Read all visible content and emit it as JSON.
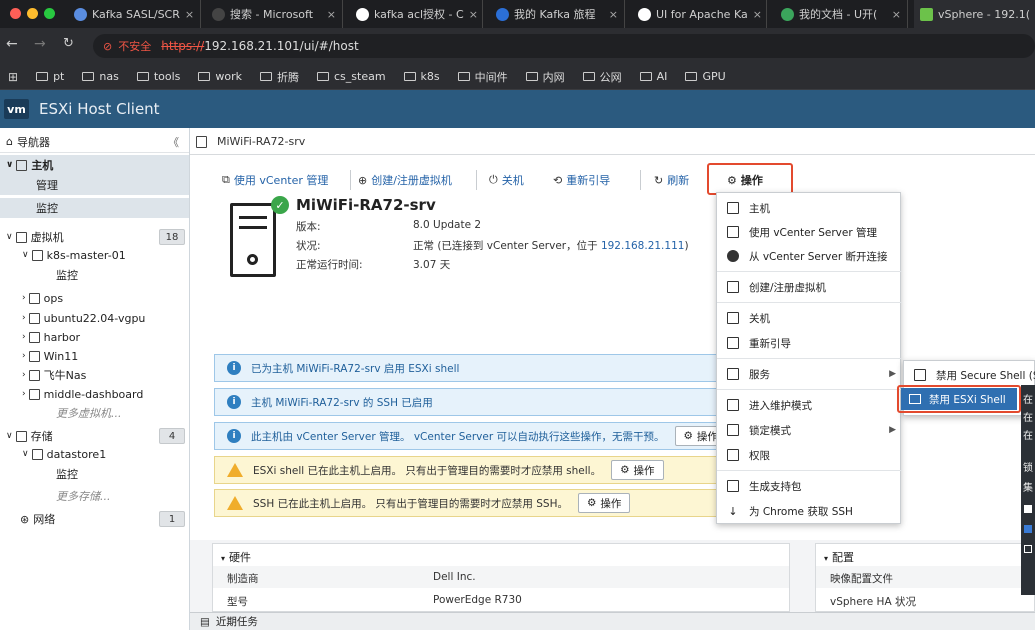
{
  "browser": {
    "tabs": [
      {
        "title": "Kafka SASL/SCR",
        "icon": "github-icon"
      },
      {
        "title": "搜索 - Microsoft",
        "icon": "search-icon"
      },
      {
        "title": "kafka acl授权 - C",
        "icon": "github-icon"
      },
      {
        "title": "我的 Kafka 旅程",
        "icon": "github-icon"
      },
      {
        "title": "UI for Apache Ka",
        "icon": "github-icon"
      },
      {
        "title": "我的文档 - U开(",
        "icon": "u-icon"
      },
      {
        "title": "vSphere - 192.1(",
        "icon": "vsphere-icon"
      }
    ],
    "security_label": "不安全",
    "url_scheme": "https://",
    "url_rest": "192.168.21.101/ui/#/host",
    "bookmarks": [
      "pt",
      "nas",
      "tools",
      "work",
      "折腾",
      "cs_steam",
      "k8s",
      "中间件",
      "内网",
      "公网",
      "AI",
      "GPU"
    ]
  },
  "app": {
    "logo_text": "vm",
    "title": "ESXi Host Client"
  },
  "navigator": {
    "title": "导航器",
    "collapse_glyph": "《",
    "items": [
      {
        "label": "主机",
        "bold": true
      },
      {
        "label": "管理"
      },
      {
        "label": "监控"
      },
      {
        "label": "虚拟机",
        "count": "18"
      },
      {
        "label": "k8s-master-01"
      },
      {
        "label": "监控"
      },
      {
        "label": "ops"
      },
      {
        "label": "ubuntu22.04-vgpu"
      },
      {
        "label": "harbor"
      },
      {
        "label": "Win11"
      },
      {
        "label": "飞牛Nas"
      },
      {
        "label": "middle-dashboard"
      },
      {
        "label": "更多虚拟机..."
      },
      {
        "label": "存储",
        "count": "4"
      },
      {
        "label": "datastore1"
      },
      {
        "label": "监控"
      },
      {
        "label": "更多存储..."
      },
      {
        "label": "网络",
        "count": "1"
      }
    ]
  },
  "main": {
    "header": "MiWiFi-RA72-srv",
    "toolbar": {
      "vcenter": "使用 vCenter 管理",
      "create_vm": "创建/注册虚拟机",
      "shutdown": "关机",
      "reboot": "重新引导",
      "refresh": "刷新",
      "actions": "操作"
    },
    "host": {
      "name": "MiWiFi-RA72-srv",
      "version_label": "版本:",
      "version_value": "8.0 Update 2",
      "state_label": "状况:",
      "state_value": "正常 (已连接到 vCenter Server，位于 ",
      "state_link": "192.168.21.111",
      "state_tail": ")",
      "uptime_label": "正常运行时间:",
      "uptime_value": "3.07 天"
    },
    "notices": [
      {
        "type": "info",
        "text": "已为主机 MiWiFi-RA72-srv 启用 ESXi shell"
      },
      {
        "type": "info",
        "text": "主机 MiWiFi-RA72-srv 的 SSH 已启用"
      },
      {
        "type": "info",
        "text": "此主机由 vCenter Server 管理。 vCenter Server 可以自动执行这些操作，无需干预。",
        "button": "操作"
      },
      {
        "type": "warn",
        "text": "ESXi shell 已在此主机上启用。 只有出于管理目的需要时才应禁用 shell。",
        "button": "操作"
      },
      {
        "type": "warn",
        "text": "SSH 已在此主机上启用。 只有出于管理目的需要时才应禁用 SSH。",
        "button": "操作"
      }
    ],
    "hardware": {
      "title": "硬件",
      "rows": [
        {
          "key": "制造商",
          "value": "Dell Inc."
        },
        {
          "key": "型号",
          "value": "PowerEdge R730"
        }
      ]
    },
    "config": {
      "title": "配置",
      "rows": [
        "映像配置文件",
        "vSphere HA 状况"
      ]
    },
    "tasks_label": "近期任务"
  },
  "menu": {
    "items": [
      "主机",
      "使用 vCenter Server 管理",
      "从 vCenter Server 断开连接",
      "创建/注册虚拟机",
      "关机",
      "重新引导",
      "服务",
      "进入维护模式",
      "锁定模式",
      "权限",
      "生成支持包",
      "为 Chrome 获取 SSH"
    ],
    "submenu": {
      "items": [
        "禁用 Secure Shell (SSH)",
        "禁用 ESXi Shell"
      ]
    },
    "right_glyphs": [
      "在",
      "在",
      "在",
      "锁",
      "集"
    ]
  },
  "colors": {
    "header_bg": "#2b5a7f",
    "link": "#2563a8",
    "highlight_border": "#e34a2e",
    "selected": "#2f6fb1"
  }
}
